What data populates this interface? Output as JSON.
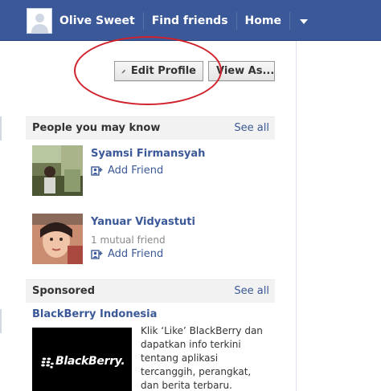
{
  "topbar": {
    "user_name": "Olive Sweet",
    "find_friends": "Find friends",
    "home": "Home"
  },
  "profile": {
    "edit_profile": "Edit Profile",
    "view_as": "View As..."
  },
  "people": {
    "title": "People you may know",
    "see_all": "See all",
    "items": [
      {
        "name": "Syamsi Firmansyah",
        "mutual": "",
        "action": "Add Friend"
      },
      {
        "name": "Yanuar Vidyastuti",
        "mutual": "1 mutual friend",
        "action": "Add Friend"
      }
    ]
  },
  "sponsored": {
    "title": "Sponsored",
    "see_all": "See all",
    "ad_title": "BlackBerry Indonesia",
    "ad_brand": "BlackBerry.",
    "ad_text": "Klik ‘Like’ BlackBerry dan dapatkan info terkini tentang aplikasi tercanggih, perangkat, dan berita terbaru."
  },
  "colors": {
    "topbar": "#3b5998",
    "link": "#3b5998",
    "annotation_circle": "#d0202a"
  }
}
